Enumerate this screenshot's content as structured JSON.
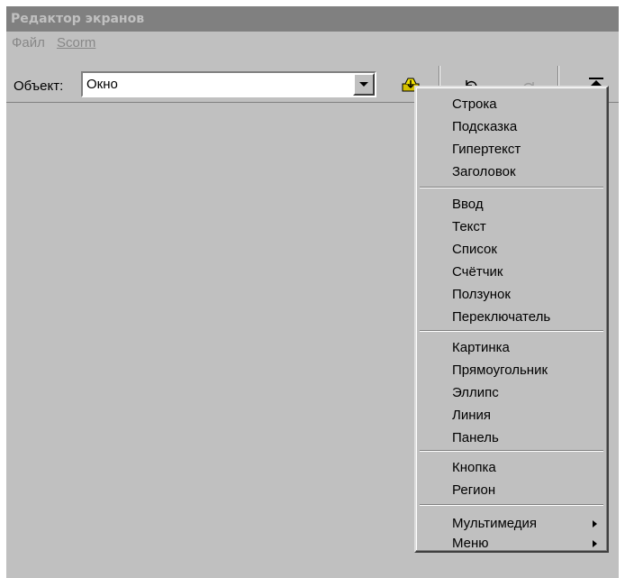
{
  "window": {
    "title": "Редактор экранов"
  },
  "menubar": {
    "file": "Файл",
    "scorm": "Scorm"
  },
  "toolbar": {
    "object_label": "Объект:",
    "object_value": "Окно",
    "icons": [
      "insert-object-icon",
      "undo-icon",
      "redo-icon",
      "upload-icon"
    ]
  },
  "context_menu": {
    "items": [
      "Строка",
      "Подсказка",
      "Гипертекст",
      "Заголовок",
      "Ввод",
      "Текст",
      "Список",
      "Счётчик",
      "Ползунок",
      "Переключатель",
      "Картинка",
      "Прямоугольник",
      "Эллипс",
      "Линия",
      "Панель",
      "Кнопка",
      "Регион",
      "Мультимедия",
      "Меню"
    ]
  },
  "colors": {
    "face": "#c0c0c0",
    "title_bar": "#808080",
    "title_text": "#c0c0c0",
    "disabled_text": "#878787"
  }
}
